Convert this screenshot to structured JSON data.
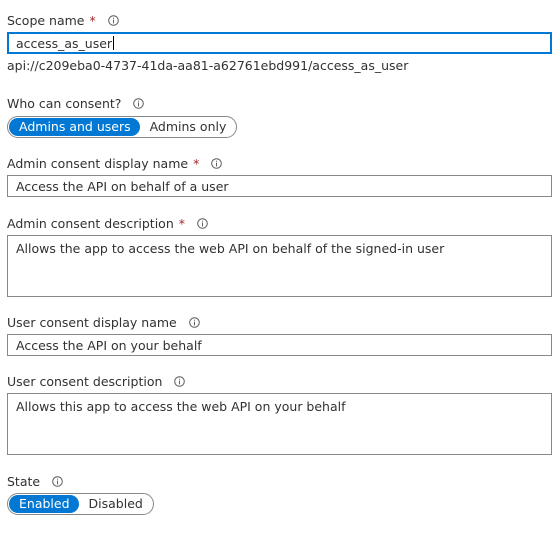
{
  "scope_name": {
    "label": "Scope name",
    "required_mark": "*",
    "value": "access_as_user",
    "uri": "api://c209eba0-4737-41da-aa81-a62761ebd991/access_as_user"
  },
  "who_can_consent": {
    "label": "Who can consent?",
    "options": [
      "Admins and users",
      "Admins only"
    ],
    "selected": "Admins and users"
  },
  "admin_display_name": {
    "label": "Admin consent display name",
    "required_mark": "*",
    "value": "Access the API on behalf of a user"
  },
  "admin_description": {
    "label": "Admin consent description",
    "required_mark": "*",
    "value": "Allows the app to access the web API on behalf of the signed-in user"
  },
  "user_display_name": {
    "label": "User consent display name",
    "value": "Access the API on your behalf"
  },
  "user_description": {
    "label": "User consent description",
    "value": "Allows this app to access the web API on your behalf"
  },
  "state": {
    "label": "State",
    "options": [
      "Enabled",
      "Disabled"
    ],
    "selected": "Enabled"
  },
  "colors": {
    "accent": "#0078d4",
    "required": "#a4262c",
    "border": "#8a8886",
    "text": "#323130"
  },
  "icons": {
    "info": "info-icon"
  }
}
